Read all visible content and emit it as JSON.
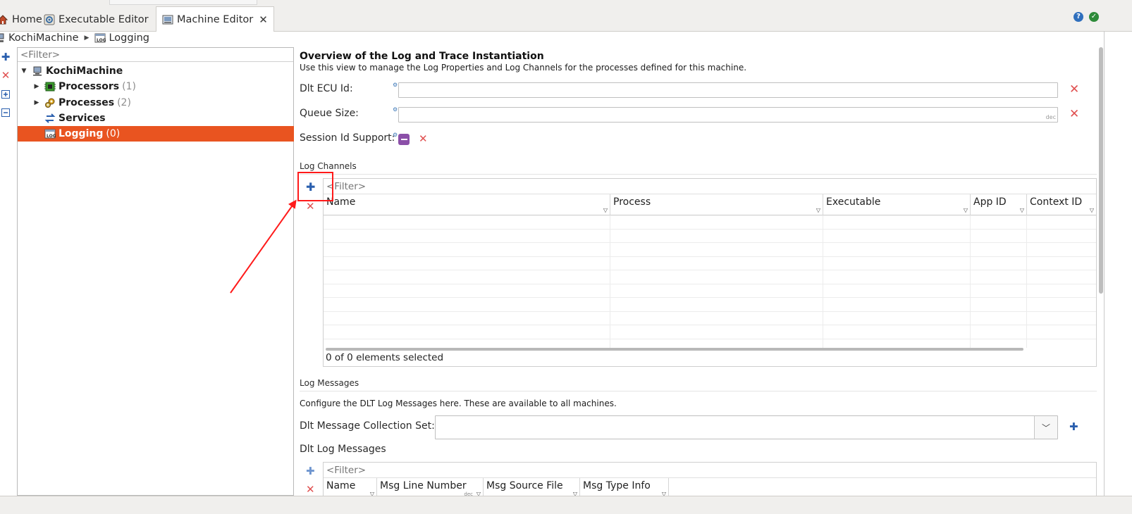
{
  "tabs": [
    {
      "label": "Home",
      "icon": "home-icon"
    },
    {
      "label": "Executable Editor",
      "icon": "executable-editor-icon"
    },
    {
      "label": "Machine Editor",
      "icon": "machine-editor-icon",
      "active": true
    }
  ],
  "breadcrumb": [
    {
      "label": "KochiMachine",
      "icon": "machine-icon"
    },
    {
      "label": "Logging",
      "icon": "log-icon"
    }
  ],
  "tree": {
    "filter_placeholder": "<Filter>",
    "root": {
      "label": "KochiMachine",
      "icon": "machine-icon"
    },
    "items": [
      {
        "label": "Processors",
        "count": "(1)",
        "icon": "processor-icon",
        "expandable": true
      },
      {
        "label": "Processes",
        "count": "(2)",
        "icon": "process-gears-icon",
        "expandable": true
      },
      {
        "label": "Services",
        "count": "",
        "icon": "services-arrows-icon",
        "expandable": false
      },
      {
        "label": "Logging",
        "count": "(0)",
        "icon": "log-icon",
        "expandable": false,
        "selected": true
      }
    ]
  },
  "overview": {
    "title": "Overview of the Log and Trace Instantiation",
    "description": "Use this view to manage the Log Properties and Log Channels for the processes defined for this machine."
  },
  "fields": {
    "dlt_ecu_id": {
      "label": "Dlt ECU Id:",
      "value": ""
    },
    "queue_size": {
      "label": "Queue Size:",
      "value": "",
      "unit": "dec"
    },
    "session_id_support": {
      "label": "Session Id Support:"
    }
  },
  "log_channels": {
    "section_label": "Log Channels",
    "filter_placeholder": "<Filter>",
    "columns": [
      "Name",
      "Process",
      "Executable",
      "App ID",
      "Context ID"
    ],
    "rows": [],
    "status": "0 of 0 elements selected"
  },
  "log_messages": {
    "section_label": "Log Messages",
    "description": "Configure the DLT Log Messages here. These are available to all machines.",
    "collection_label": "Dlt Message Collection Set:",
    "collection_value": "",
    "dlt_log_messages_label": "Dlt Log Messages",
    "filter_placeholder": "<Filter>",
    "columns": [
      "Name",
      "Msg Line Number",
      "Msg Source File",
      "Msg Type Info"
    ],
    "msg_line_unit": "dec"
  },
  "colors": {
    "selection": "#e95420",
    "delete": "#e05050",
    "add": "#2a5fae",
    "annotation": "#ff1a1a"
  }
}
